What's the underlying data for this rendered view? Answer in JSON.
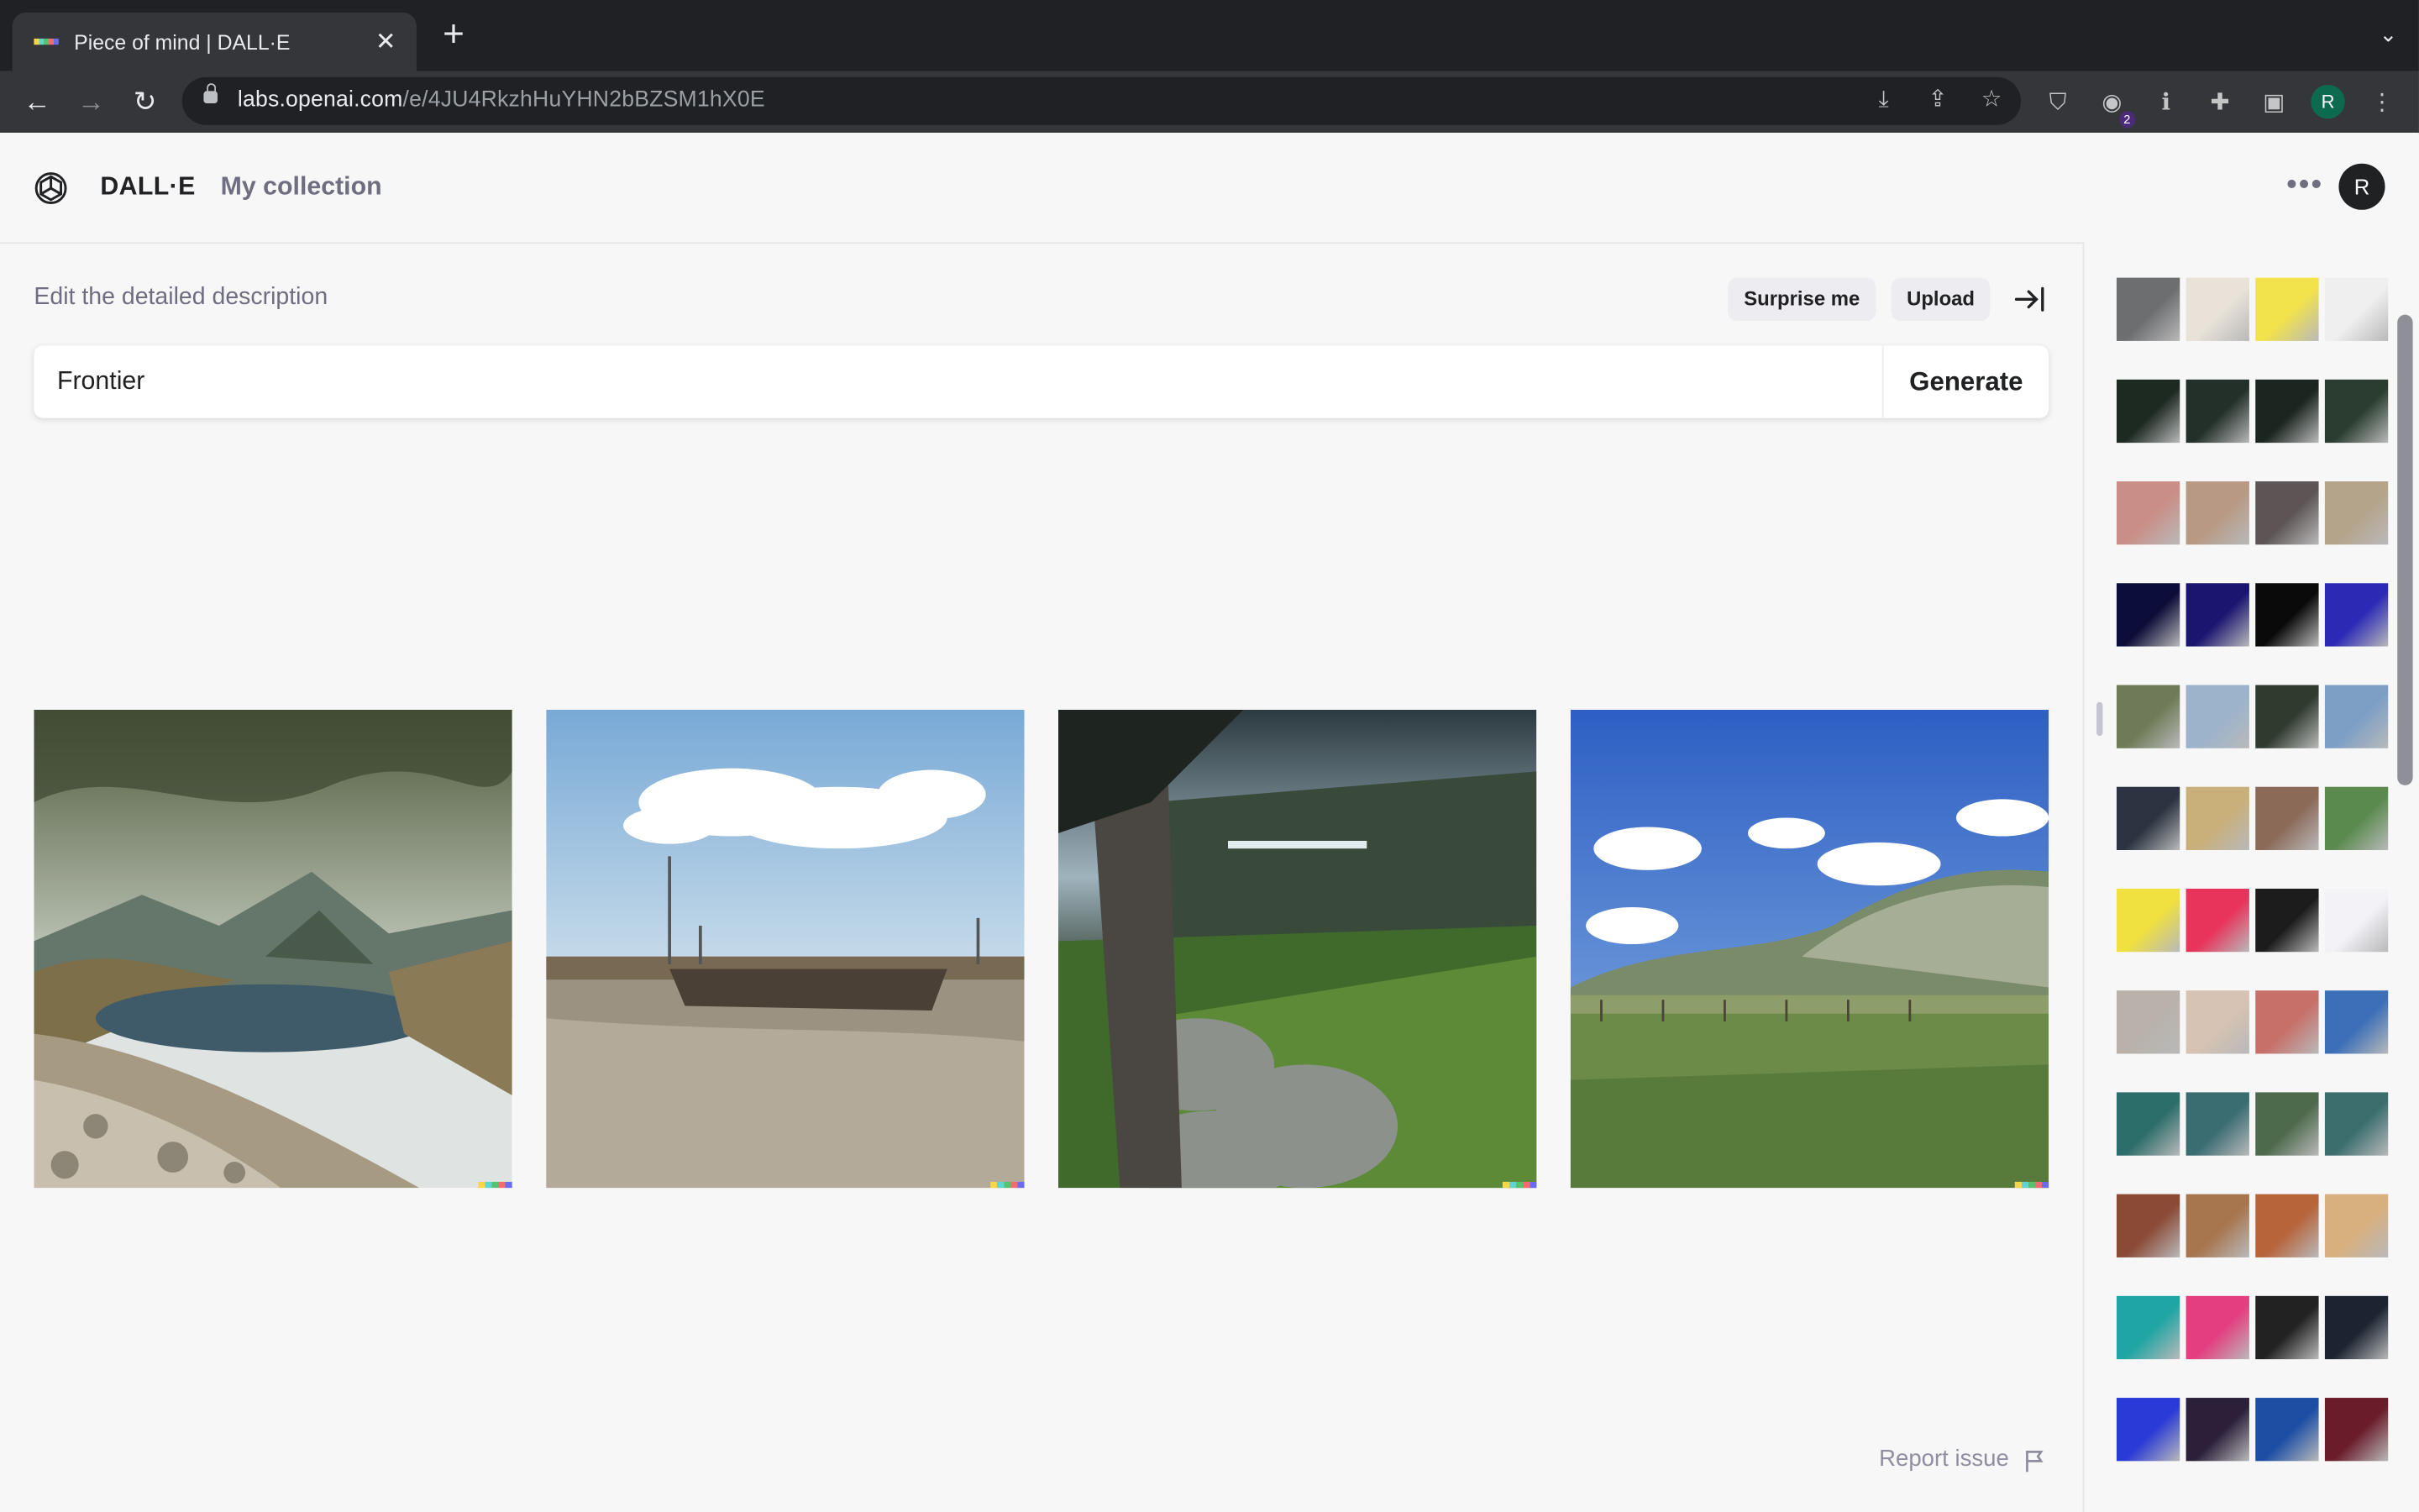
{
  "browser": {
    "tab_title": "Piece of mind | DALL·E",
    "url_host": "labs.openai.com",
    "url_path": "/e/4JU4RkzhHuYHN2bBZSM1hX0E",
    "extension_badge": "2",
    "profile_initial": "R"
  },
  "header": {
    "brand": "DALL·E",
    "my_collection": "My collection",
    "avatar_initial": "R"
  },
  "editor": {
    "label": "Edit the detailed description",
    "surprise_label": "Surprise me",
    "upload_label": "Upload",
    "prompt_value": "Frontier",
    "generate_label": "Generate"
  },
  "footer": {
    "report_label": "Report issue"
  },
  "colors": {
    "accent": "#202123",
    "muted": "#6e6e80",
    "background": "#f7f7f8"
  },
  "history_thumbnails": [
    [
      "#6d6e70",
      "#e8e2d8",
      "#f2e24c",
      "#efefef"
    ],
    [
      "#1d2a22",
      "#23302a",
      "#1b2620",
      "#2a3d30"
    ],
    [
      "#c98f86",
      "#b89a84",
      "#5d5555",
      "#b4a48a"
    ],
    [
      "#0d0d3a",
      "#1a1670",
      "#0a0a0a",
      "#2c2ab5"
    ],
    [
      "#6f7b58",
      "#9bb3cb",
      "#2f3b2f",
      "#7d9fc6"
    ],
    [
      "#2b3440",
      "#c9b07a",
      "#8b6a58",
      "#5a8a4e"
    ],
    [
      "#f0e040",
      "#e8335a",
      "#1c1c1c",
      "#f2f2f7"
    ],
    [
      "#b8b2aa",
      "#d6c3b3",
      "#c77069",
      "#3b6fb8"
    ],
    [
      "#2c6e6a",
      "#3a6d72",
      "#4d6a4c",
      "#3c6e6e"
    ],
    [
      "#8a4a35",
      "#a7764f",
      "#b7643a",
      "#d8b07e"
    ],
    [
      "#1fa6a4",
      "#e43e7e",
      "#222222",
      "#1b2430"
    ],
    [
      "#2a3ad6",
      "#2b1f3a",
      "#1c4fa4",
      "#6a1c2a"
    ]
  ]
}
